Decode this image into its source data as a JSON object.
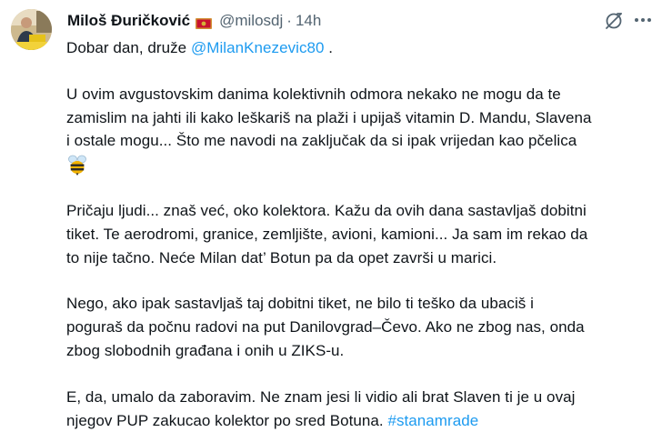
{
  "author": {
    "name": "Miloš Đuričković",
    "handle": "@milosdj",
    "separator": "·",
    "time": "14h"
  },
  "colors": {
    "link": "#1d9bf0",
    "secondary": "#536471",
    "text": "#0f1419"
  },
  "icons": {
    "flag": "montenegro-flag-icon",
    "grok": "grok-icon",
    "more": "more-options-icon",
    "bee": "honeybee-icon"
  },
  "post": {
    "greeting": "Dobar dan, druže ",
    "mention": "@MilanKnezevic80",
    "greeting_end": " .",
    "p1": [
      "U ovim avgustovskim danima kolektivnih odmora nekako ne mogu da te",
      "zamislim na jahti ili kako leškariš na plaži i upijaš vitamin D. Mandu, Slavena",
      "i ostale mogu... Što me navodi na zaključak da si ipak vrijedan kao pčelica"
    ],
    "p2": [
      "Pričaju ljudi... znaš već, oko kolektora. Kažu da ovih dana sastavljaš dobitni",
      "tiket. Te aerodromi, granice, zemljište, avioni, kamioni... Ja sam im rekao da",
      "to nije tačno. Neće Milan dat’ Botun pa da opet završi u marici."
    ],
    "p3": [
      "Nego, ako ipak sastavljaš taj dobitni tiket, ne bilo ti teško da ubaciš i",
      "poguraš da počnu radovi na put Danilovgrad–Čevo. Ako ne zbog nas, onda",
      "zbog slobodnih građana i onih u ZIKS-u."
    ],
    "p4_line1": "E, da, umalo da zaboravim. Ne znam jesi li vidio ali brat Slaven ti je u ovaj",
    "p4_line2": "njegov PUP zakucao kolektor po sred Botuna. ",
    "hashtag": "#stanamrade"
  }
}
